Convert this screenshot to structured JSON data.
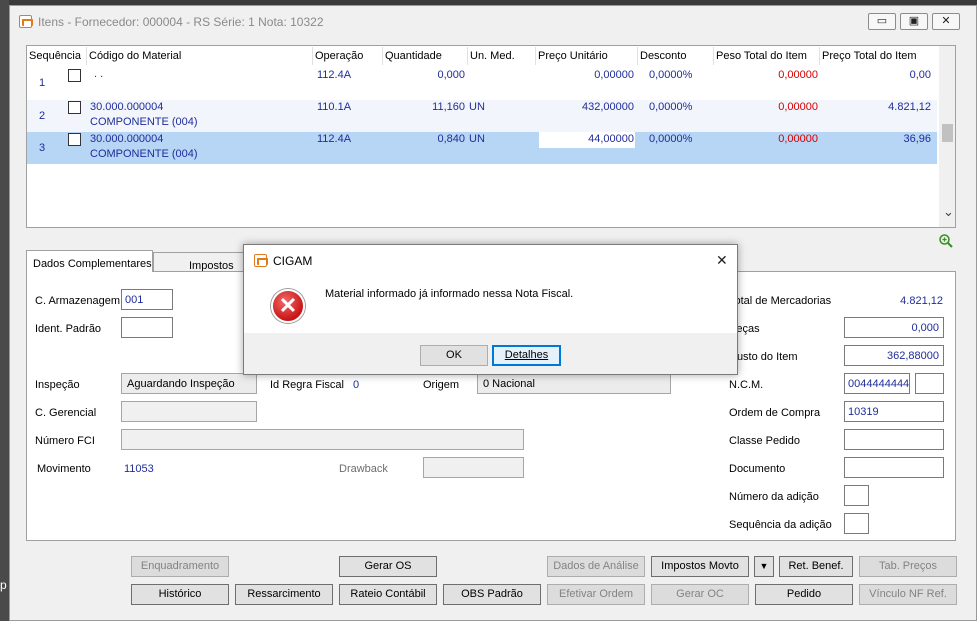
{
  "window": {
    "title": "Itens - Fornecedor: 000004 - RS Série: 1    Nota: 10322",
    "minimize_glyph": "▭",
    "maximize_glyph": "▣",
    "close_glyph": "✕"
  },
  "grid": {
    "columns": [
      "Sequência",
      "Código do Material",
      "Operação",
      "Quantidade",
      "Un. Med.",
      "Preço Unitário",
      "Desconto",
      "Peso Total do Item",
      "Preço Total do Item"
    ],
    "rows": [
      {
        "seq": "1",
        "code": ".  .",
        "desc": "",
        "op": "112.4A",
        "qty": "0,000",
        "unit": "",
        "price": "0,00000",
        "disc": "0,0000%",
        "weight": "0,00000",
        "total": "0,00"
      },
      {
        "seq": "2",
        "code": "30.000.000004",
        "desc": "COMPONENTE (004)",
        "op": "110.1A",
        "qty": "11,160",
        "unit": "UN",
        "price": "432,00000",
        "disc": "0,0000%",
        "weight": "0,00000",
        "total": "4.821,12"
      },
      {
        "seq": "3",
        "code": "30.000.000004",
        "desc": "COMPONENTE (004)",
        "op": "112.4A",
        "qty": "0,840",
        "unit": "UN",
        "price": "44,00000",
        "disc": "0,0000%",
        "weight": "0,00000",
        "total": "36,96"
      }
    ],
    "scroll_down_glyph": "⌄"
  },
  "tabs": {
    "dados": "Dados Complementares",
    "impostos": "Impostos"
  },
  "form": {
    "armazenagem_label": "C. Armazenagem",
    "armazenagem_value": "001",
    "ident_label": "Ident. Padrão",
    "ident_value": "",
    "inspecao_label": "Inspeção",
    "inspecao_value": "Aguardando Inspeção",
    "regra_label": "Id Regra Fiscal",
    "regra_value": "0",
    "origem_label": "Origem",
    "origem_value": "0 Nacional",
    "gerencial_label": "C. Gerencial",
    "fci_label": "Número FCI",
    "movimento_label": "Movimento",
    "movimento_value": "11053",
    "drawback_label": "Drawback",
    "total_merc_label": "Total de Mercadorias",
    "total_merc_value": "4.821,12",
    "pecas_label": "Peças",
    "pecas_value": "0,000",
    "custo_label": "Custo do Item",
    "custo_value": "362,88000",
    "ncm_label": "N.C.M.",
    "ncm_value": "0044444444",
    "ordem_label": "Ordem de Compra",
    "ordem_value": "10319",
    "classe_label": "Classe Pedido",
    "documento_label": "Documento",
    "adicao_label": "Número da adição",
    "seq_adicao_label": "Sequência da adição"
  },
  "buttons": {
    "enquadramento": "Enquadramento",
    "gerar_os": "Gerar OS",
    "dados_analise": "Dados de Análise",
    "impostos_movto": "Impostos Movto",
    "dropdown_glyph": "▼",
    "ret_benef": "Ret. Benef.",
    "tab_precos": "Tab. Preços",
    "historico": "Histórico",
    "ressarcimento": "Ressarcimento",
    "rateio": "Rateio Contábil",
    "obs_padrao": "OBS Padrão",
    "efetivar": "Efetivar Ordem",
    "gerar_oc": "Gerar OC",
    "pedido": "Pedido",
    "vinculo": "Vínculo NF Ref."
  },
  "dialog": {
    "title": "CIGAM",
    "message": "Material informado já informado nessa Nota Fiscal.",
    "ok": "OK",
    "detalhes": "Detalhes",
    "close_glyph": "✕",
    "error_glyph": "✕"
  },
  "side_text": "p",
  "colors": {
    "accent_blue": "#1f2d9a",
    "selected_row": "#b7d5f5",
    "negative_red": "#d40000"
  }
}
